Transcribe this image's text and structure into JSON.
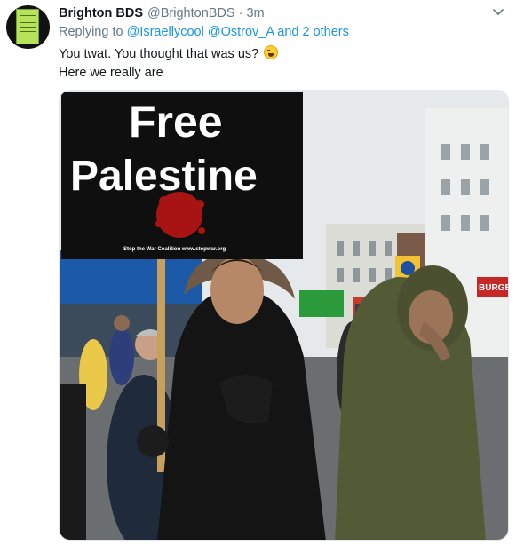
{
  "tweet": {
    "display_name": "Brighton BDS",
    "handle": "@BrightonBDS",
    "separator": "·",
    "time": "3m",
    "reply_prefix": "Replying to",
    "mention_1": "@Israellycool",
    "mention_2": "@Ostrov_A",
    "reply_suffix": "and 2 others",
    "text_line_1": "You twat. You thought that was us?",
    "text_line_2": "Here we really are",
    "icons": {
      "avatar": "protest-sign-avatar",
      "menu": "chevron-down-icon",
      "emoji": "face-with-tears-of-joy-emoji"
    },
    "colors": {
      "link": "#1b95e0",
      "secondary": "#657786",
      "text": "#14171a"
    }
  },
  "photo": {
    "placard_line_1": "Free",
    "placard_line_2": "Palestine",
    "placard_small_print": "Stop the War Coalition www.stopwar.org",
    "shop_sign": "BURGE"
  }
}
